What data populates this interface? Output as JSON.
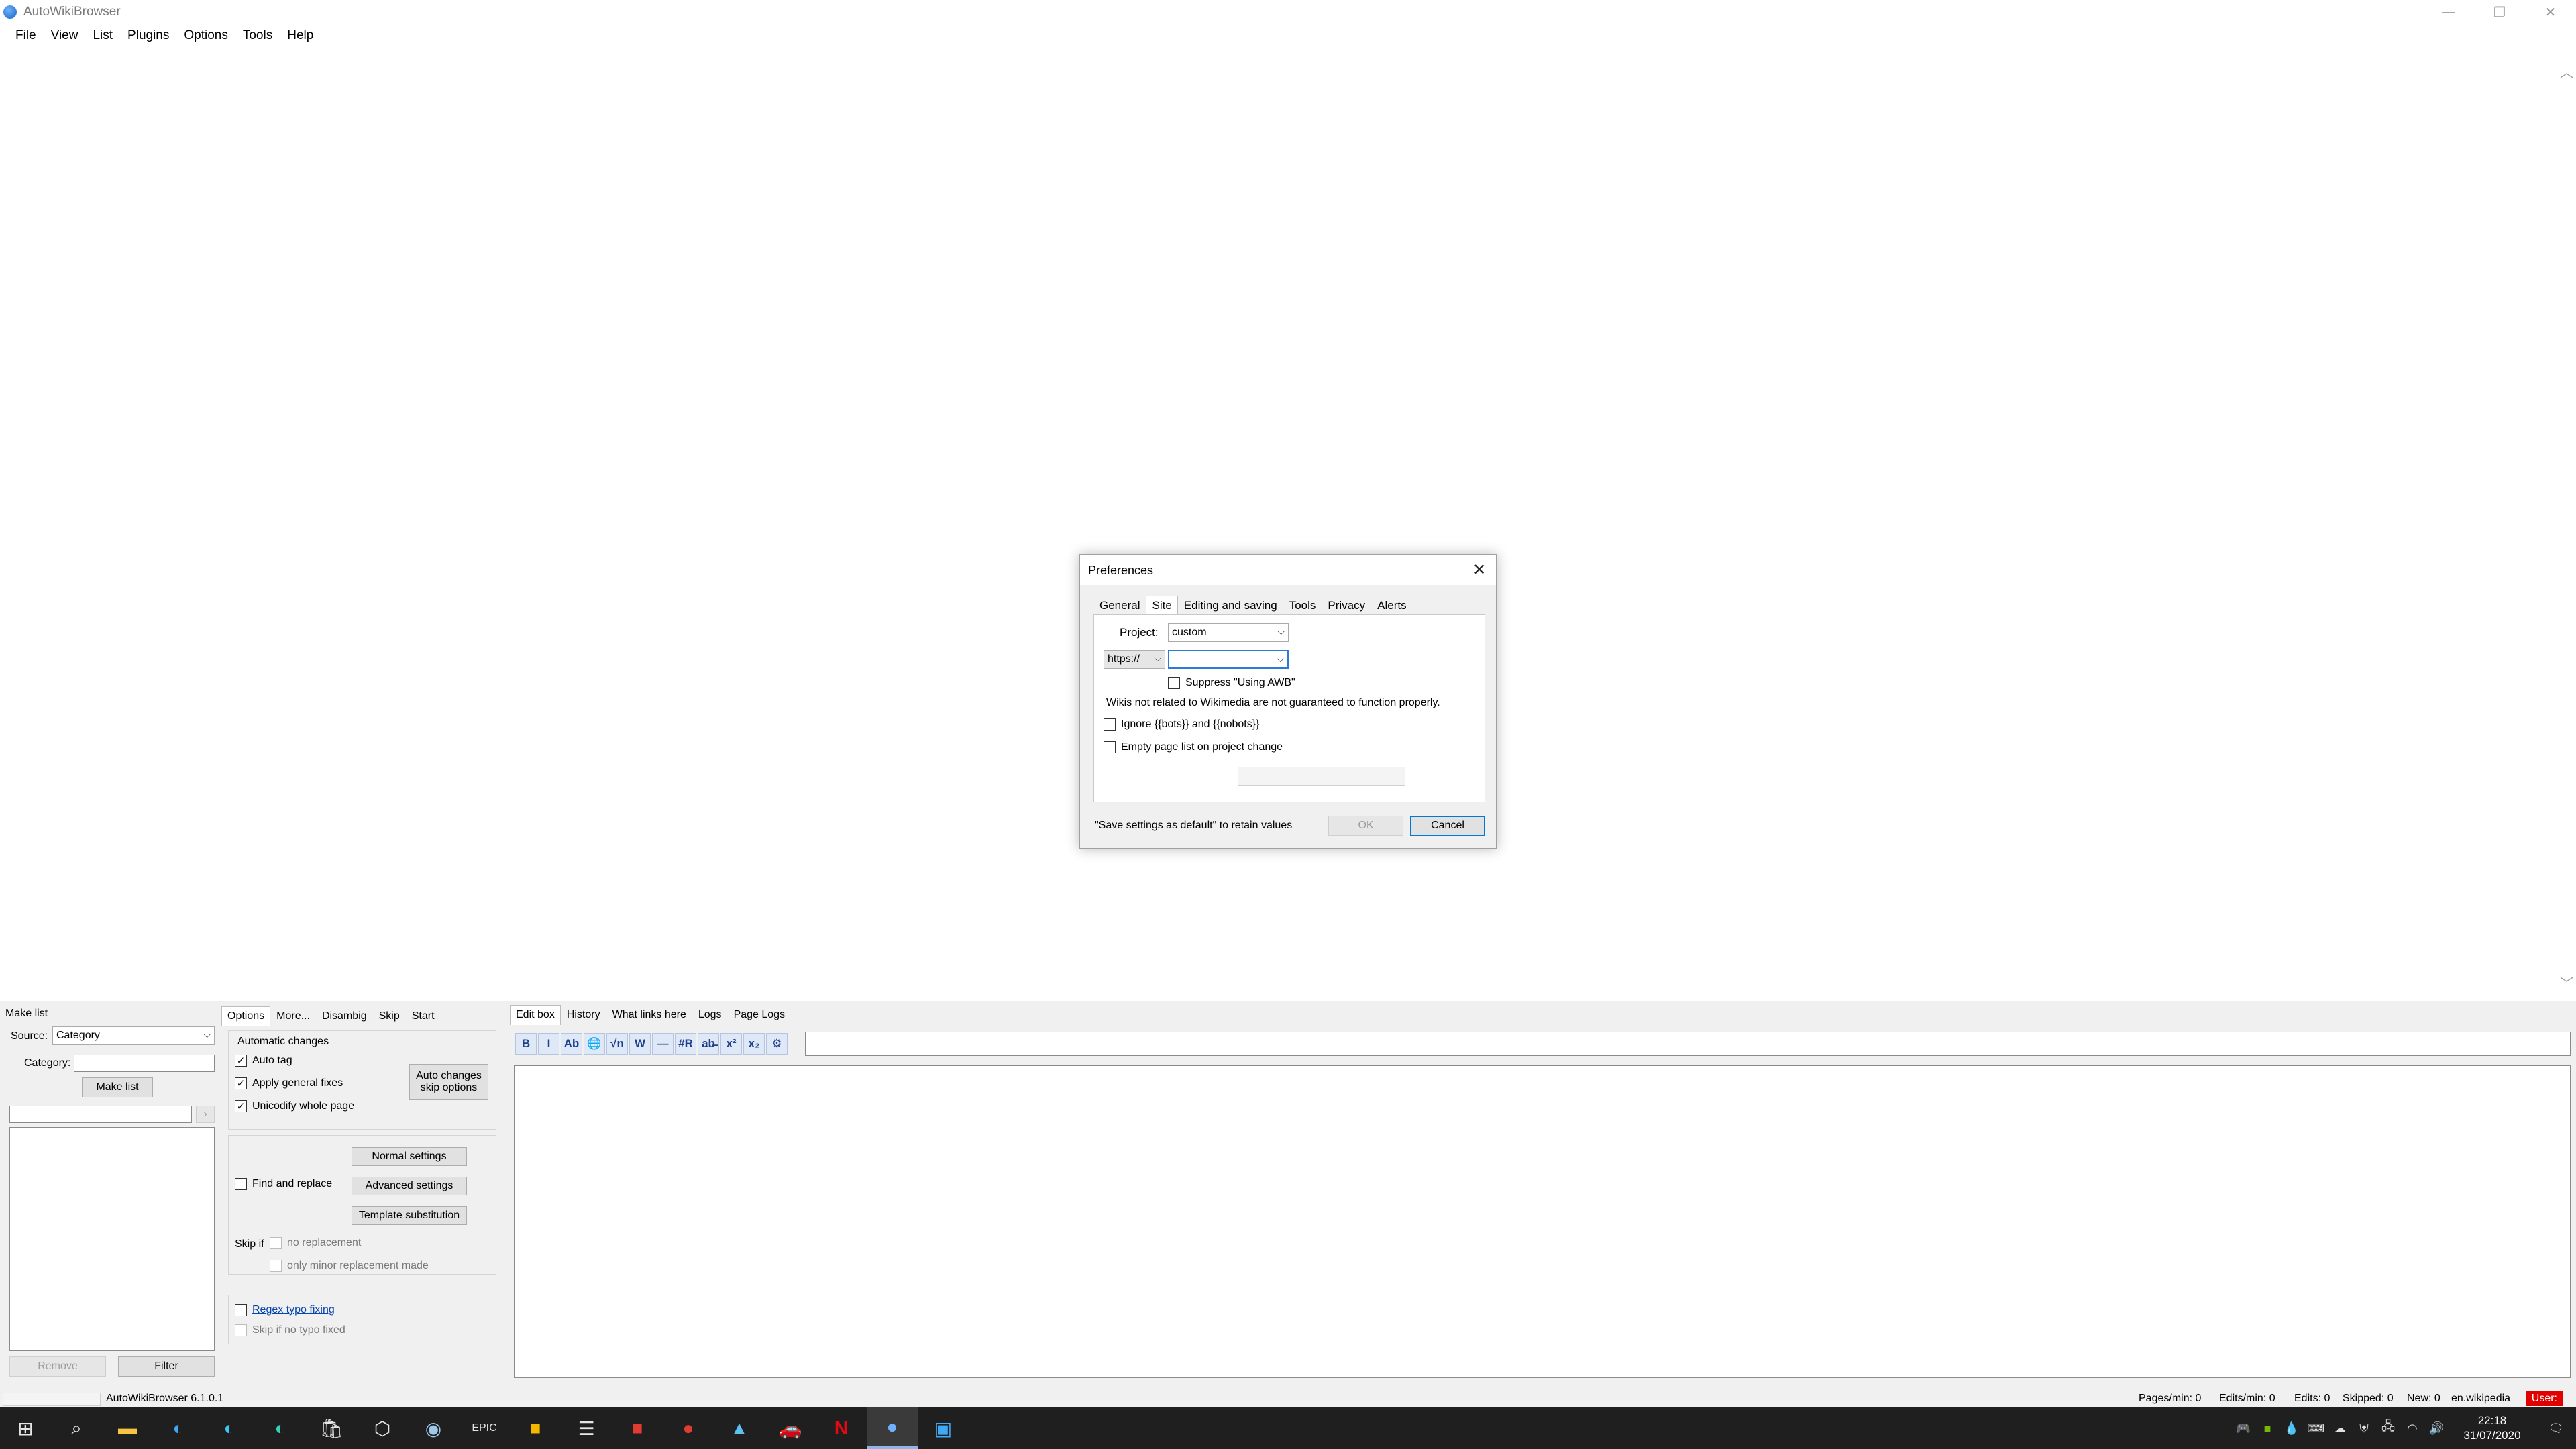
{
  "window": {
    "title": "AutoWikiBrowser",
    "minimize_glyph": "—",
    "maximize_glyph": "❐",
    "close_glyph": "✕"
  },
  "menu": {
    "items": [
      "File",
      "View",
      "List",
      "Plugins",
      "Options",
      "Tools",
      "Help"
    ]
  },
  "dialog": {
    "title": "Preferences",
    "close_glyph": "✕",
    "tabs": [
      "General",
      "Site",
      "Editing and saving",
      "Tools",
      "Privacy",
      "Alerts"
    ],
    "active_tab": "Site",
    "project_label": "Project:",
    "project_value": "custom",
    "protocol_value": "https://",
    "url_value": "",
    "suppress_label": "Suppress \"Using AWB\"",
    "warning_text": "Wikis not related to Wikimedia are not guaranteed to function properly.",
    "ignore_bots_label": "Ignore {{bots}} and {{nobots}}",
    "empty_pagelist_label": "Empty page list on project change",
    "footer_hint": "\"Save settings as default\" to retain values",
    "ok_label": "OK",
    "cancel_label": "Cancel"
  },
  "make_list": {
    "heading": "Make list",
    "source_label": "Source:",
    "source_value": "Category",
    "category_label": "Category:",
    "category_value": "",
    "make_list_button": "Make list",
    "remove_button": "Remove",
    "filter_button": "Filter"
  },
  "options_panel": {
    "tabs": [
      "Options",
      "More...",
      "Disambig",
      "Skip",
      "Start"
    ],
    "active_tab": "Options",
    "auto_changes_heading": "Automatic changes",
    "auto_tag": "Auto tag",
    "apply_general_fixes": "Apply general fixes",
    "unicodify": "Unicodify whole page",
    "auto_changes_skip_button_l1": "Auto changes",
    "auto_changes_skip_button_l2": "skip options",
    "normal_settings": "Normal settings",
    "find_and_replace": "Find and replace",
    "advanced_settings": "Advanced settings",
    "template_substitution": "Template substitution",
    "skip_if": "Skip if",
    "no_replacement": "no replacement",
    "only_minor": "only minor replacement made",
    "regex_typo": "Regex typo fixing",
    "skip_if_no_typo": "Skip if no typo fixed"
  },
  "edit_panel": {
    "tabs": [
      "Edit box",
      "History",
      "What links here",
      "Logs",
      "Page Logs"
    ],
    "active_tab": "Edit box",
    "toolbar": [
      "B",
      "I",
      "Ab",
      "🌐",
      "√n",
      "W",
      "—",
      "#R",
      "ab̶",
      "x²",
      "x₂",
      "⚙"
    ]
  },
  "status": {
    "version": "AutoWikiBrowser 6.1.0.1",
    "pages_per_min": "Pages/min: 0",
    "edits_per_min": "Edits/min: 0",
    "edits": "Edits: 0",
    "skipped": "Skipped: 0",
    "new": "New: 0",
    "site": "en.wikipedia",
    "user": "User:"
  },
  "taskbar": {
    "icons": [
      "windows-icon",
      "search-icon",
      "file-explorer-icon",
      "edge-icon",
      "edge-beta-icon",
      "edge-dev-icon",
      "store-icon",
      "unity-icon",
      "steam-icon",
      "epic-icon",
      "rockstar-icon",
      "stack-icon",
      "autodesk-icon",
      "gamespot-icon",
      "affinity-icon",
      "car-icon",
      "netflix-icon",
      "awb-icon",
      "photos-icon"
    ],
    "time": "22:18",
    "date": "31/07/2020"
  }
}
